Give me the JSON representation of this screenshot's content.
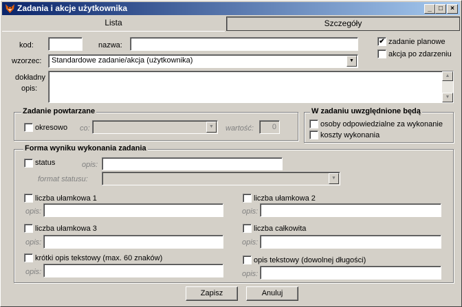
{
  "window": {
    "title": "Zadania i akcje użytkownika"
  },
  "tabs": [
    {
      "label": "Lista"
    },
    {
      "label": "Szczegóły"
    }
  ],
  "form": {
    "kod_label": "kod:",
    "nazwa_label": "nazwa:",
    "wzorzec_label": "wzorzec:",
    "wzorzec_value": "Standardowe zadanie/akcja (użytkownika)",
    "zadanie_planowe_label": "zadanie planowe",
    "zadanie_planowe_checked": true,
    "akcja_po_zdarzeniu_label": "akcja po zdarzeniu",
    "akcja_po_zdarzeniu_checked": false,
    "opis_label_1": "dokładny",
    "opis_label_2": "opis:"
  },
  "zadanie_powtarzane": {
    "title": "Zadanie powtarzane",
    "okresowo_label": "okresowo",
    "co_label": "co:",
    "wartosc_label": "wartość:",
    "wartosc_value": "0"
  },
  "uwzglednione": {
    "title": "W zadaniu uwzględnione będą",
    "osoby_label": "osoby odpowiedzialne za wykonanie",
    "koszty_label": "koszty wykonania"
  },
  "forma": {
    "title": "Forma wyniku wykonania zadania",
    "status_label": "status",
    "opis_label": "opis:",
    "format_statusu_label": "format statusu:",
    "liczba_ulamkowa_1": "liczba ułamkowa 1",
    "liczba_ulamkowa_2": "liczba ułamkowa 2",
    "liczba_ulamkowa_3": "liczba ułamkowa 3",
    "liczba_calkowita": "liczba całkowita",
    "krotki_opis": "krótki opis tekstowy (max. 60 znaków)",
    "opis_tekstowy": "opis tekstowy (dowolnej długości)"
  },
  "buttons": {
    "zapisz": "Zapisz",
    "anuluj": "Anuluj"
  },
  "icons": {
    "app": "fox-icon",
    "check": "✔"
  }
}
